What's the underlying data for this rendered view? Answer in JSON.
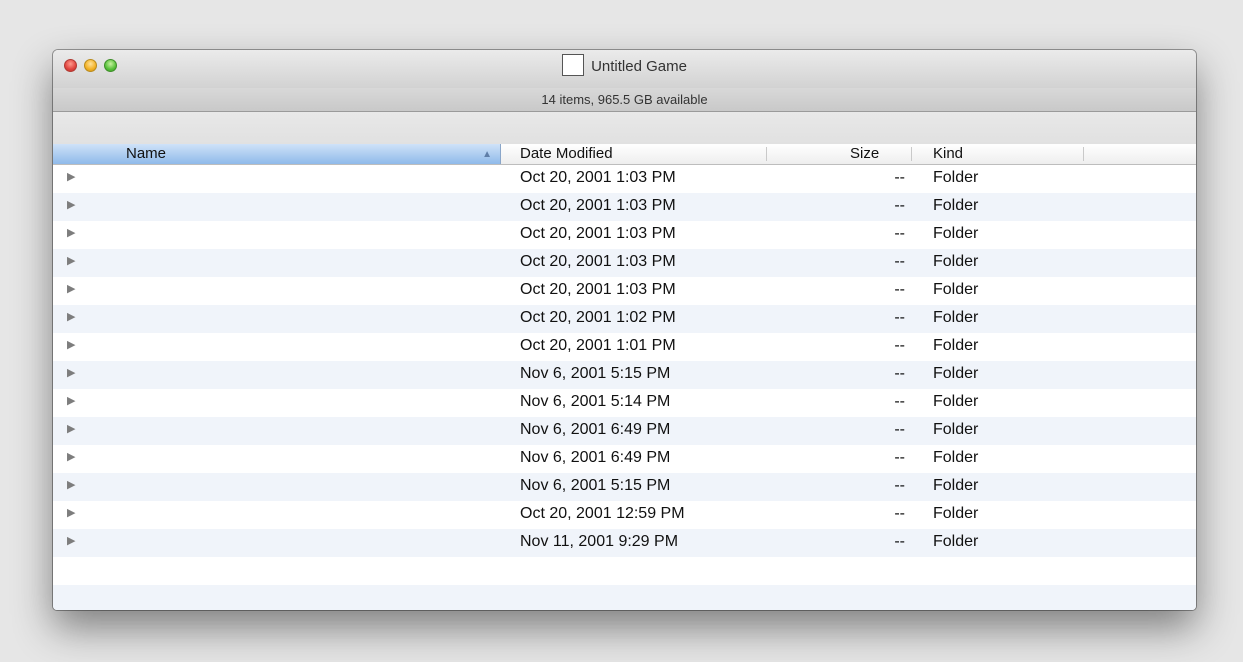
{
  "window": {
    "title": "Untitled Game",
    "status": "14 items, 965.5 GB available"
  },
  "columns": {
    "name": "Name",
    "date": "Date Modified",
    "size": "Size",
    "kind": "Kind"
  },
  "icons": {
    "disclosure": "disclosure-triangle-icon",
    "sort": "sort-ascending-icon",
    "document": "document-icon"
  },
  "colors": {
    "header_selected": "#8fbaea",
    "row_alt": "#f0f4fa"
  },
  "rows": [
    {
      "date": "Oct 20, 2001 1:03 PM",
      "size": "--",
      "kind": "Folder"
    },
    {
      "date": "Oct 20, 2001 1:03 PM",
      "size": "--",
      "kind": "Folder"
    },
    {
      "date": "Oct 20, 2001 1:03 PM",
      "size": "--",
      "kind": "Folder"
    },
    {
      "date": "Oct 20, 2001 1:03 PM",
      "size": "--",
      "kind": "Folder"
    },
    {
      "date": "Oct 20, 2001 1:03 PM",
      "size": "--",
      "kind": "Folder"
    },
    {
      "date": "Oct 20, 2001 1:02 PM",
      "size": "--",
      "kind": "Folder"
    },
    {
      "date": "Oct 20, 2001 1:01 PM",
      "size": "--",
      "kind": "Folder"
    },
    {
      "date": "Nov 6, 2001 5:15 PM",
      "size": "--",
      "kind": "Folder"
    },
    {
      "date": "Nov 6, 2001 5:14 PM",
      "size": "--",
      "kind": "Folder"
    },
    {
      "date": "Nov 6, 2001 6:49 PM",
      "size": "--",
      "kind": "Folder"
    },
    {
      "date": "Nov 6, 2001 6:49 PM",
      "size": "--",
      "kind": "Folder"
    },
    {
      "date": "Nov 6, 2001 5:15 PM",
      "size": "--",
      "kind": "Folder"
    },
    {
      "date": "Oct 20, 2001 12:59 PM",
      "size": "--",
      "kind": "Folder"
    },
    {
      "date": "Nov 11, 2001 9:29 PM",
      "size": "--",
      "kind": "Folder"
    }
  ]
}
